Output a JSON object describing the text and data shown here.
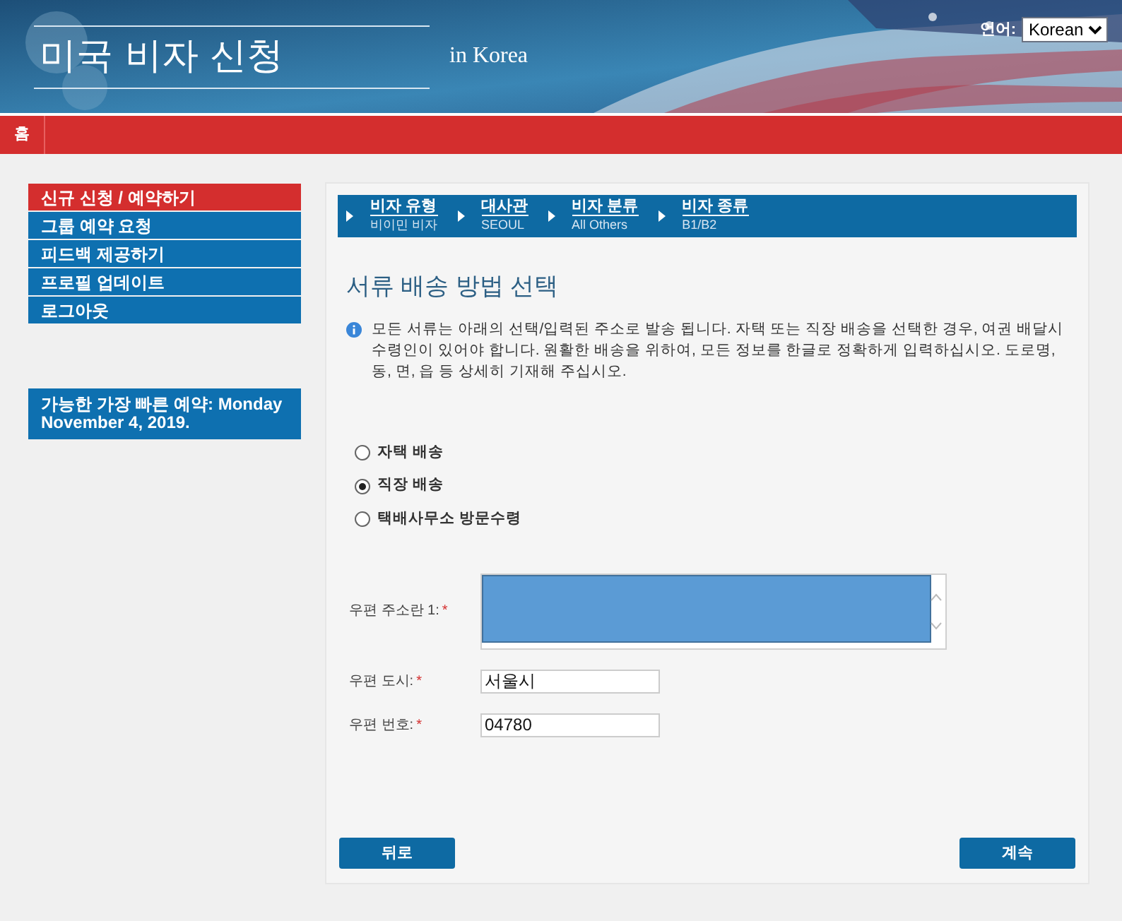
{
  "header": {
    "title": "미국 비자 신청",
    "subtitle": "in Korea",
    "language_label": "언어:",
    "language": "Korean"
  },
  "nav": [
    {
      "label": "홈",
      "selected": false
    }
  ],
  "sidebar": {
    "items": [
      {
        "label": "신규 신청 / 예약하기",
        "selected": true
      },
      {
        "label": "그룹 예약 요청",
        "selected": false
      },
      {
        "label": "피드백 제공하기",
        "selected": false
      },
      {
        "label": "프로필 업데이트",
        "selected": false
      },
      {
        "label": "로그아웃",
        "selected": false
      }
    ],
    "notice": "가능한 가장 빠른 예약: Monday November 4, 2019."
  },
  "breadcrumb": [
    {
      "title": "비자 유형",
      "value": "비이민 비자"
    },
    {
      "title": "대사관",
      "value": "SEOUL"
    },
    {
      "title": "비자 분류",
      "value": "All Others"
    },
    {
      "title": "비자 종류",
      "value": "B1/B2"
    }
  ],
  "heading": "서류 배송 방법 선택",
  "info": "모든 서류는 아래의 선택/입력된 주소로 발송 됩니다. 자택 또는 직장 배송을 선택한 경우, 여권 배달시 수령인이 있어야 합니다. 원활한 배송을 위하여, 모든 정보를 한글로 정확하게 입력하십시오. 도로명, 동, 면, 읍 등 상세히 기재해 주십시오.",
  "options": [
    {
      "label": "자택 배송",
      "selected": false
    },
    {
      "label": "직장 배송",
      "selected": true
    },
    {
      "label": "택배사무소 방문수령",
      "selected": false
    }
  ],
  "fields": [
    {
      "kind": "textarea",
      "label": "우편 주소란 1:",
      "required_mark": "*",
      "redacted": true
    },
    {
      "kind": "input",
      "label": "우편 도시:",
      "required_mark": "*",
      "value": "서울시"
    },
    {
      "kind": "input",
      "label": "우편 번호:",
      "required_mark": "*",
      "value": "04780"
    }
  ],
  "buttons": {
    "back": "뒤로",
    "next": "계속"
  }
}
